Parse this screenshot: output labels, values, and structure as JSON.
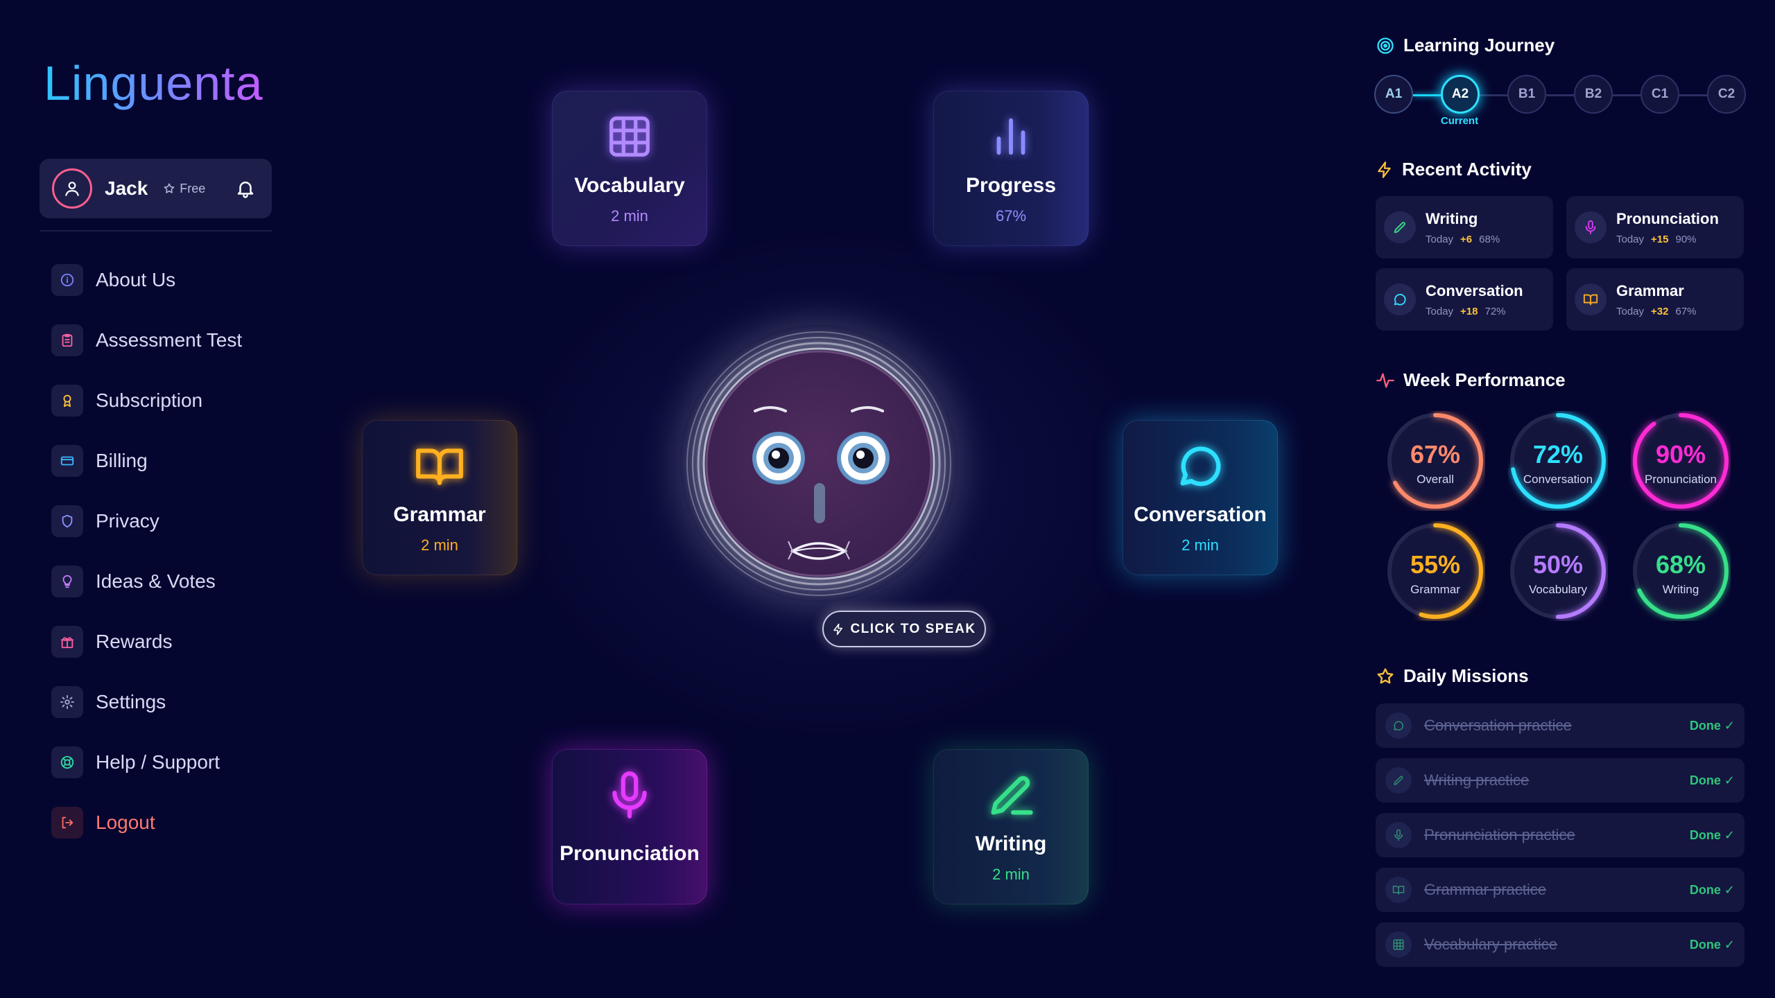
{
  "app": {
    "logo": "Linguenta"
  },
  "user": {
    "name": "Jack",
    "plan": "Free"
  },
  "menu": [
    {
      "label": "About Us",
      "icon": "info-icon",
      "color": "#7b82ff"
    },
    {
      "label": "Assessment Test",
      "icon": "clipboard-icon",
      "color": "#ff5fa0"
    },
    {
      "label": "Subscription",
      "icon": "award-icon",
      "color": "#ffc23a"
    },
    {
      "label": "Billing",
      "icon": "credit-card-icon",
      "color": "#3db8ff"
    },
    {
      "label": "Privacy",
      "icon": "shield-icon",
      "color": "#8a8fff"
    },
    {
      "label": "Ideas & Votes",
      "icon": "lightbulb-icon",
      "color": "#c77dff"
    },
    {
      "label": "Rewards",
      "icon": "gift-icon",
      "color": "#ff5fa0"
    },
    {
      "label": "Settings",
      "icon": "gear-icon",
      "color": "#a7abd6"
    },
    {
      "label": "Help / Support",
      "icon": "life-buoy-icon",
      "color": "#2fd9a0"
    },
    {
      "label": "Logout",
      "icon": "logout-icon",
      "color": "#ff6b60"
    }
  ],
  "cards": {
    "vocabulary": {
      "title": "Vocabulary",
      "sub": "2 min",
      "color": "#9a6bff"
    },
    "progress": {
      "title": "Progress",
      "sub": "67%",
      "color": "#7d7dff"
    },
    "grammar": {
      "title": "Grammar",
      "sub": "2 min",
      "color": "#ffb020"
    },
    "conversation": {
      "title": "Conversation",
      "sub": "2 min",
      "color": "#2ee0ff"
    },
    "pronunciation": {
      "title": "Pronunciation",
      "color": "#e53bff"
    },
    "writing": {
      "title": "Writing",
      "sub": "2 min",
      "color": "#36e08a"
    }
  },
  "speak_button": "CLICK TO SPEAK",
  "journey": {
    "title": "Learning Journey",
    "levels": [
      "A1",
      "A2",
      "B1",
      "B2",
      "C1",
      "C2"
    ],
    "current_index": 1,
    "current_label": "Current"
  },
  "recent_activity": {
    "title": "Recent Activity",
    "items": [
      {
        "title": "Writing",
        "when": "Today",
        "points": "+6",
        "score": "68%",
        "icon": "pencil-icon",
        "color": "#36e08a"
      },
      {
        "title": "Pronunciation",
        "when": "Today",
        "points": "+15",
        "score": "90%",
        "icon": "microphone-icon",
        "color": "#e53bff"
      },
      {
        "title": "Conversation",
        "when": "Today",
        "points": "+18",
        "score": "72%",
        "icon": "chat-bubble-icon",
        "color": "#2ee0ff"
      },
      {
        "title": "Grammar",
        "when": "Today",
        "points": "+32",
        "score": "67%",
        "icon": "book-icon",
        "color": "#ffb020"
      }
    ]
  },
  "week_performance": {
    "title": "Week Performance",
    "items": [
      {
        "value": "67%",
        "pct": 67,
        "label": "Overall",
        "color": "#ff8a6b"
      },
      {
        "value": "72%",
        "pct": 72,
        "label": "Conversation",
        "color": "#2ee0ff"
      },
      {
        "value": "90%",
        "pct": 90,
        "label": "Pronunciation",
        "color": "#ff2bd6"
      },
      {
        "value": "55%",
        "pct": 55,
        "label": "Grammar",
        "color": "#ffb020"
      },
      {
        "value": "50%",
        "pct": 50,
        "label": "Vocabulary",
        "color": "#b57bff"
      },
      {
        "value": "68%",
        "pct": 68,
        "label": "Writing",
        "color": "#36e08a"
      }
    ]
  },
  "daily_missions": {
    "title": "Daily Missions",
    "items": [
      {
        "label": "Conversation practice",
        "status": "Done ✓",
        "icon": "chat-bubble-icon"
      },
      {
        "label": "Writing practice",
        "status": "Done ✓",
        "icon": "pencil-icon"
      },
      {
        "label": "Pronunciation practice",
        "status": "Done ✓",
        "icon": "microphone-icon"
      },
      {
        "label": "Grammar practice",
        "status": "Done ✓",
        "icon": "book-icon"
      },
      {
        "label": "Vocabulary practice",
        "status": "Done ✓",
        "icon": "grid-icon"
      }
    ]
  }
}
